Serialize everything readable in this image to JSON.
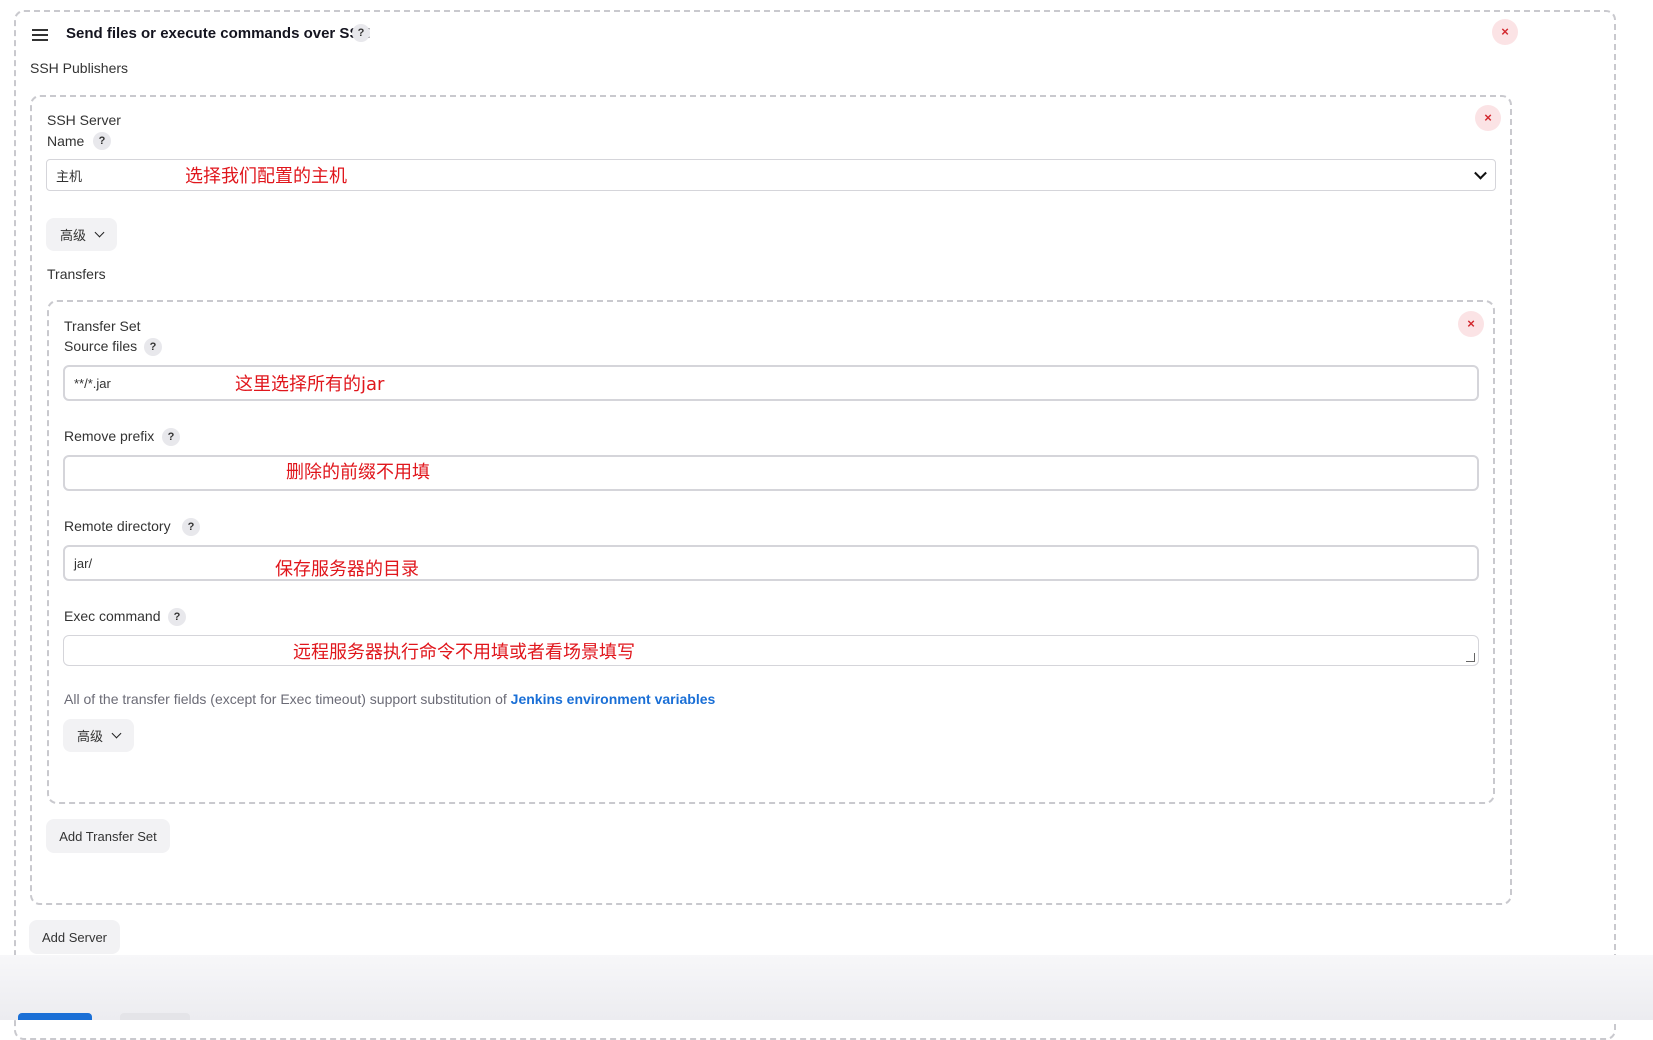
{
  "header": {
    "title": "Send files or execute commands over SSH",
    "help_glyph": "?",
    "close_glyph": "×"
  },
  "ssh_publishers": {
    "label": "SSH Publishers",
    "server": {
      "section_label": "SSH Server",
      "name_label": "Name",
      "name_value": "主机",
      "name_annotation": "选择我们配置的主机",
      "advanced_button": "高级",
      "transfers_label": "Transfers",
      "transfer_set": {
        "section_label": "Transfer Set",
        "source_files_label": "Source files",
        "source_files_value": "**/*.jar",
        "source_files_annotation": "这里选择所有的jar",
        "remove_prefix_label": "Remove prefix",
        "remove_prefix_value": "",
        "remove_prefix_annotation": "删除的前缀不用填",
        "remote_directory_label": "Remote directory",
        "remote_directory_value": "jar/",
        "remote_directory_annotation": "保存服务器的目录",
        "exec_command_label": "Exec command",
        "exec_command_value": "",
        "exec_command_annotation": "远程服务器执行命令不用填或者看场景填写",
        "note_text": "All of the transfer fields (except for Exec timeout) support substitution of ",
        "note_link": "Jenkins environment variables",
        "advanced_button": "高级"
      },
      "add_transfer_set_button": "Add Transfer Set"
    },
    "add_server_button": "Add Server"
  },
  "colors": {
    "accent_link": "#1a6fd6",
    "annotation_red": "#e0161c",
    "close_red": "#d2282e"
  }
}
